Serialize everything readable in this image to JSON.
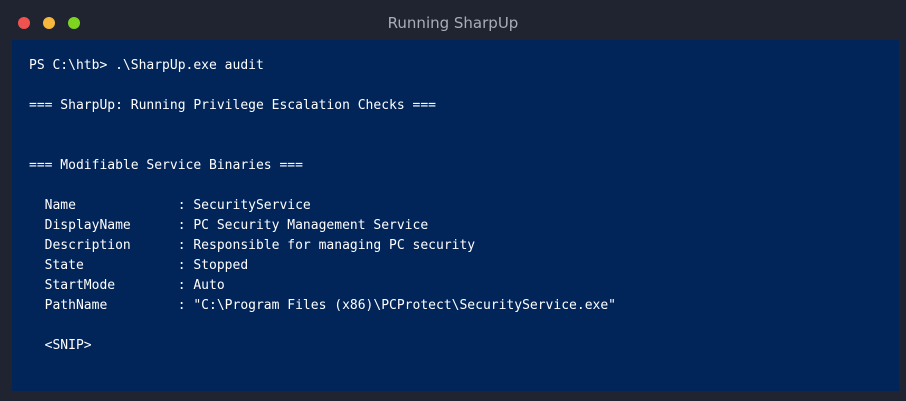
{
  "window": {
    "title": "Running SharpUp"
  },
  "terminal": {
    "lines": [
      "PS C:\\htb> .\\SharpUp.exe audit",
      "",
      "=== SharpUp: Running Privilege Escalation Checks ===",
      "",
      "",
      "=== Modifiable Service Binaries ===",
      "",
      "  Name             : SecurityService",
      "  DisplayName      : PC Security Management Service",
      "  Description      : Responsible for managing PC security",
      "  State            : Stopped",
      "  StartMode        : Auto",
      "  PathName         : \"C:\\Program Files (x86)\\PCProtect\\SecurityService.exe\"",
      "",
      "  <SNIP>"
    ]
  }
}
